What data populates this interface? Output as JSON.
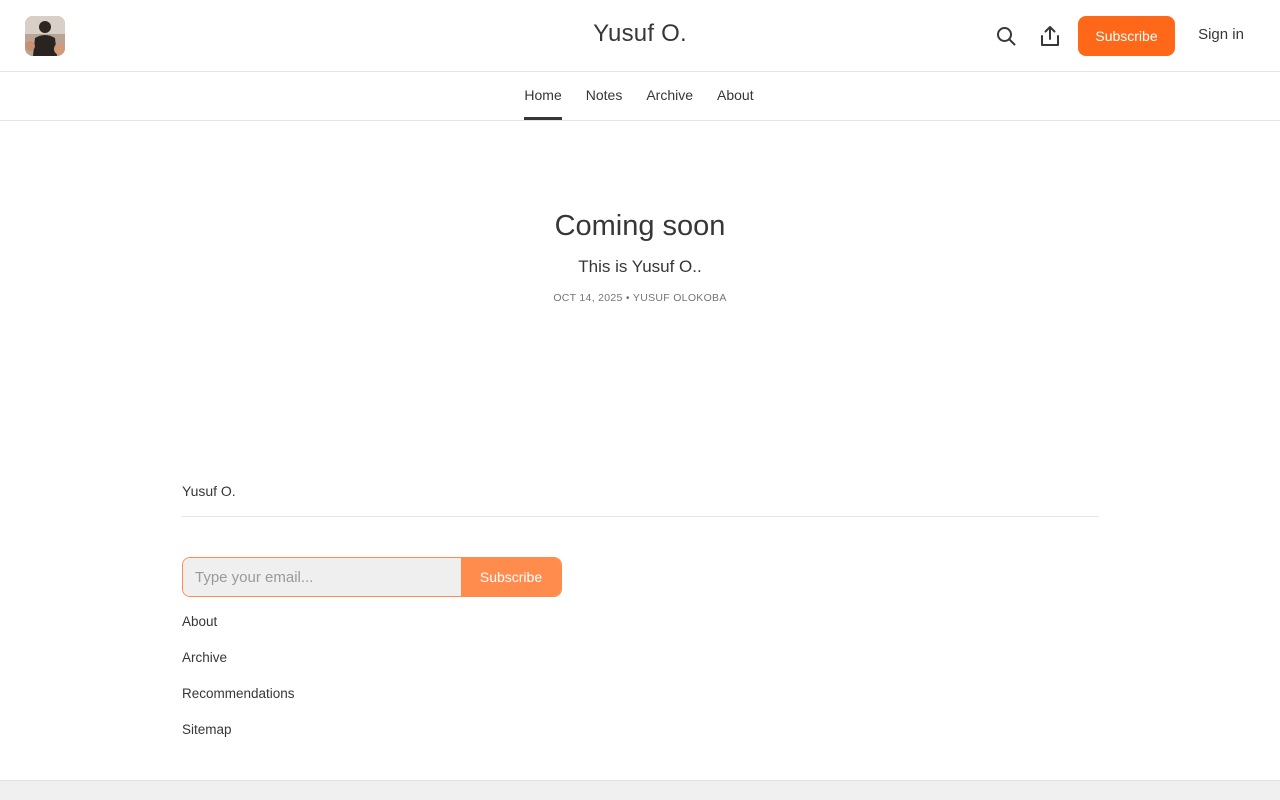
{
  "header": {
    "site_title": "Yusuf O.",
    "subscribe_label": "Subscribe",
    "signin_label": "Sign in",
    "icons": [
      "avatar",
      "search-icon",
      "share-icon"
    ]
  },
  "nav": {
    "items": [
      {
        "label": "Home",
        "active": true
      },
      {
        "label": "Notes",
        "active": false
      },
      {
        "label": "Archive",
        "active": false
      },
      {
        "label": "About",
        "active": false
      }
    ]
  },
  "hero": {
    "title": "Coming soon",
    "subtitle": "This is Yusuf O..",
    "meta": "OCT 14, 2025 • YUSUF OLOKOBA"
  },
  "footer": {
    "site_name": "Yusuf O.",
    "email_placeholder": "Type your email...",
    "subscribe_label": "Subscribe",
    "links": [
      "About",
      "Archive",
      "Recommendations",
      "Sitemap"
    ]
  },
  "colors": {
    "accent": "#ff6719",
    "accent_light": "#ff8c4d",
    "text": "#363737",
    "muted": "#757575",
    "divider": "#e6e6e6"
  }
}
